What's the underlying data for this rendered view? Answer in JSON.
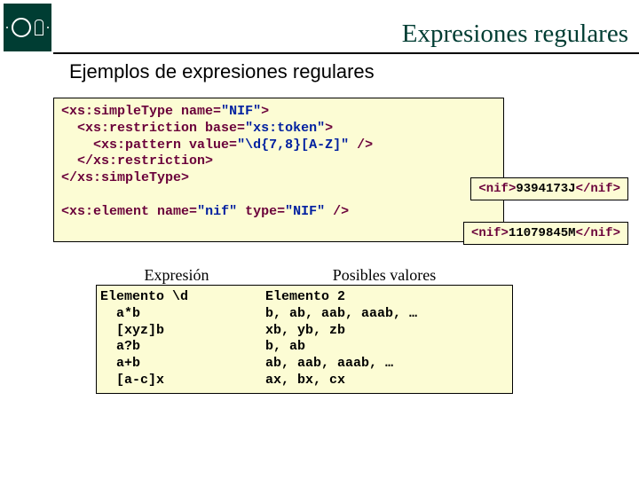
{
  "title": "Expresiones regulares",
  "subtitle": "Ejemplos de expresiones regulares",
  "code": {
    "l1a": "<xs:simpleType ",
    "l1b": "name",
    "l1c": "=",
    "l1d": "\"NIF\"",
    "l1e": ">",
    "l2a": "  <xs:restriction ",
    "l2b": "base",
    "l2c": "=",
    "l2d": "\"xs:token\"",
    "l2e": ">",
    "l3a": "    <xs:pattern ",
    "l3b": "value",
    "l3c": "=",
    "l3d": "\"\\d{7,8}[A-Z]\"",
    "l3e": " />",
    "l4": "  </xs:restriction>",
    "l5": "</xs:simpleType>",
    "l6blank": " ",
    "l7a": "<xs:element ",
    "l7b": "name",
    "l7c": "=",
    "l7d": "\"nif\"",
    "l7e": " ",
    "l7f": "type",
    "l7g": "=",
    "l7h": "\"NIF\"",
    "l7i": " />"
  },
  "nif1": {
    "open": "<nif>",
    "val": "9394173J",
    "close": "</nif>"
  },
  "nif2": {
    "open": "<nif>",
    "val": "11079845M",
    "close": "</nif>"
  },
  "table": {
    "head_expr": "Expresión",
    "head_vals": "Posibles valores",
    "expr": "Elemento \\d\n  a*b\n  [xyz]b\n  a?b\n  a+b\n  [a-c]x",
    "vals": "Elemento 2\nb, ab, aab, aaab, …\nxb, yb, zb\nb, ab\nab, aab, aaab, …\nax, bx, cx"
  }
}
